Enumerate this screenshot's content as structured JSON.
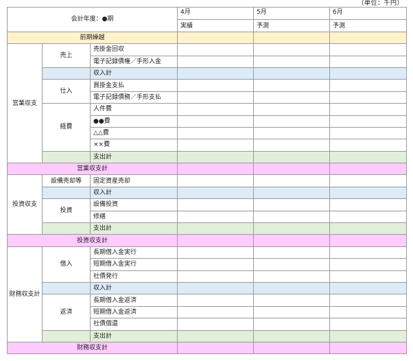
{
  "unit_label": "（単位：千円）",
  "header": {
    "fiscal_year_label": "会計年度：●期",
    "months": [
      "4月",
      "5月",
      "6月"
    ],
    "types": [
      "実績",
      "予測",
      "予測"
    ]
  },
  "rows": {
    "carryover": "前期繰越",
    "operating": {
      "section": "営業収支",
      "sales": "売上",
      "sales_items": [
        "売掛金回収",
        "電子記録債権／手形入金"
      ],
      "income_total": "収入計",
      "purchase": "仕入",
      "purchase_items": [
        "買掛金支払",
        "電子記録債務／手形支払"
      ],
      "expenses": "経費",
      "expense_items": [
        "人件費",
        "●●費",
        "△△費",
        "××費"
      ],
      "expense_total": "支出計",
      "balance": "営業収支計"
    },
    "investment": {
      "section": "投資収支",
      "asset_sales": "設備売却等",
      "asset_sale_item": "固定資産売却",
      "income_total": "収入計",
      "investment": "投資",
      "investment_items": [
        "設備投資",
        "修繕"
      ],
      "expense_total": "支出計",
      "balance": "投資収支計"
    },
    "finance": {
      "section": "財務収支計",
      "borrowing": "借入",
      "borrowing_items": [
        "長期借入金実行",
        "短期借入金実行",
        "社債発行"
      ],
      "income_total": "収入計",
      "repayment": "返済",
      "repayment_items": [
        "長期借入金返済",
        "短期借入金返済",
        "社債償還"
      ],
      "expense_total": "支出計",
      "balance": "財務収支計"
    }
  },
  "colors": {
    "carryover": "#fff2cc",
    "income_total": "#ddebf7",
    "expense_total": "#e2efda",
    "balance": "#ffccff"
  }
}
